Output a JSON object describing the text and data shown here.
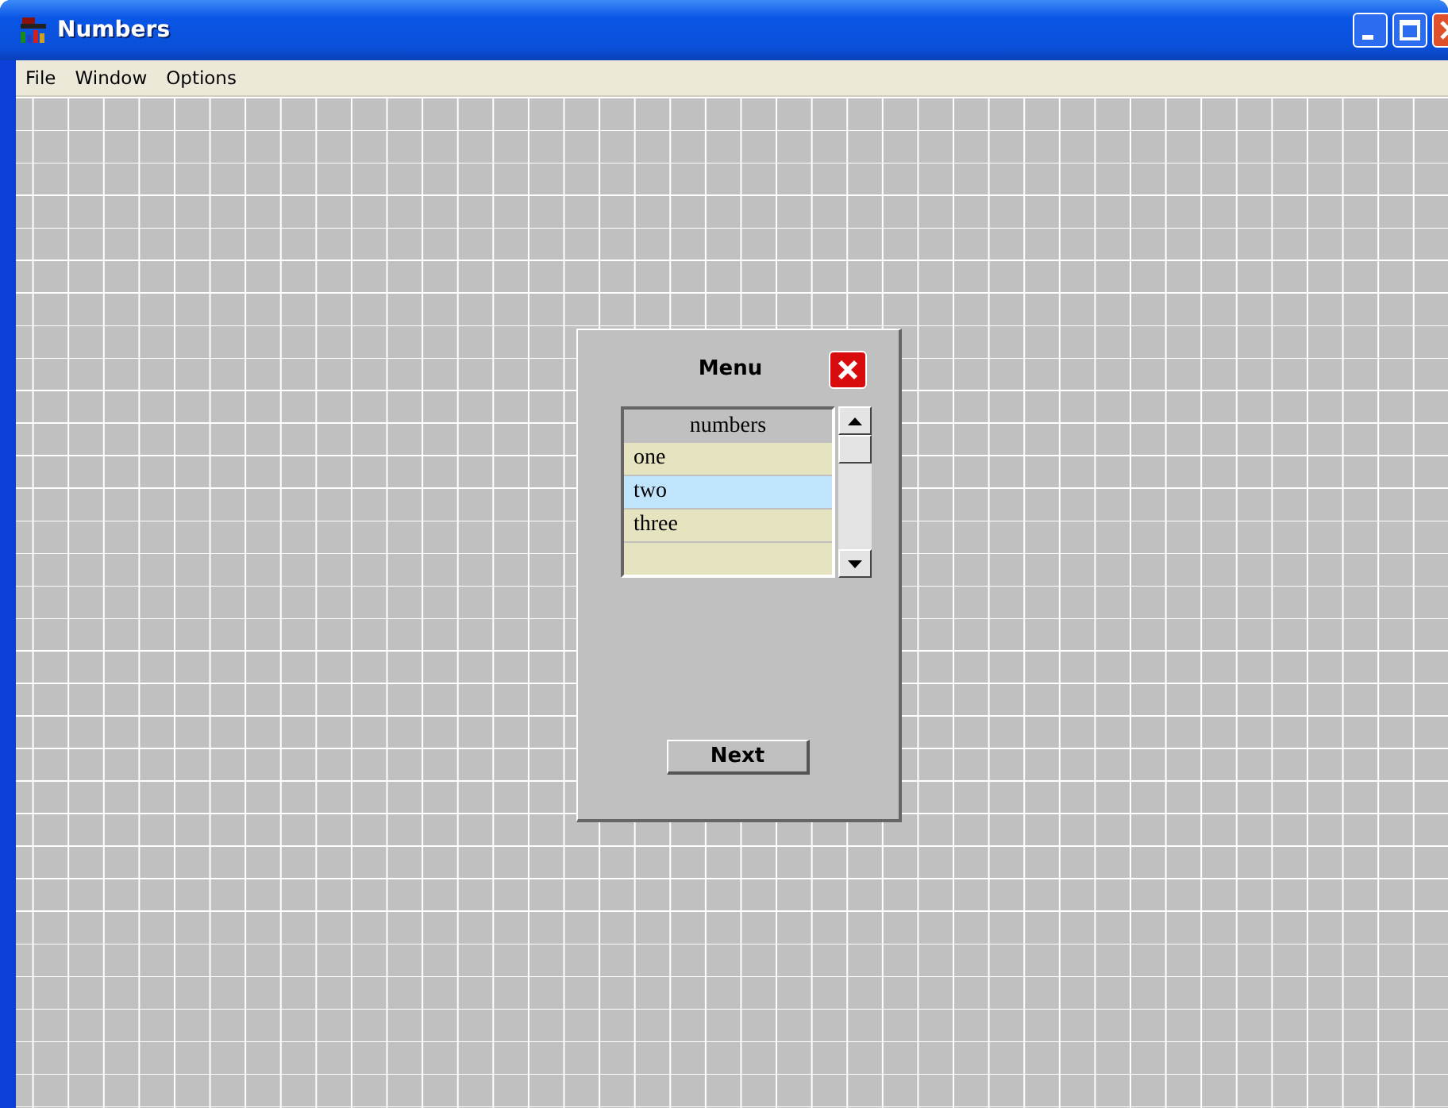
{
  "window": {
    "title": "Numbers"
  },
  "menu_bar": [
    "File",
    "Window",
    "Options"
  ],
  "dialog": {
    "title": "Menu",
    "list": {
      "header": "numbers",
      "rows": [
        {
          "label": "one",
          "selected": false
        },
        {
          "label": "two",
          "selected": true
        },
        {
          "label": "three",
          "selected": false
        }
      ]
    },
    "button": "Next"
  }
}
